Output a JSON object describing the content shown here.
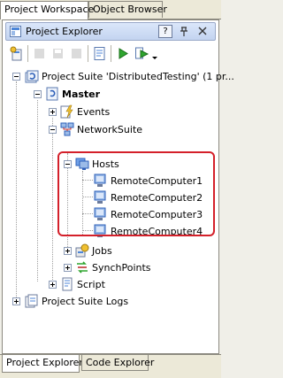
{
  "top_tabs": [
    {
      "label": "Project Workspace",
      "active": true
    },
    {
      "label": "Object Browser",
      "active": false
    }
  ],
  "explorer": {
    "title": "Project Explorer",
    "header_buttons": [
      "?",
      "pin",
      "x"
    ]
  },
  "toolbar": {
    "icons": [
      "add-item-icon",
      "edit-icon",
      "save-icon",
      "copy-icon",
      "properties-icon",
      "run-icon",
      "run-test-icon",
      "dropdown-icon"
    ]
  },
  "tree": {
    "suite": "Project Suite 'DistributedTesting' (1 pr...",
    "master": "Master",
    "events": "Events",
    "network_suite": "NetworkSuite",
    "hosts": "Hosts",
    "computers": [
      "RemoteComputer1",
      "RemoteComputer2",
      "RemoteComputer3",
      "RemoteComputer4"
    ],
    "jobs": "Jobs",
    "synch_points": "SynchPoints",
    "script": "Script",
    "suite_logs": "Project Suite Logs"
  },
  "bottom_tabs": [
    {
      "label": "Project Explorer",
      "active": true
    },
    {
      "label": "Code Explorer",
      "active": false
    }
  ],
  "colors": {
    "highlight": "#d4202a",
    "header_gradient_top": "#dbe7fa",
    "header_gradient_bottom": "#c3d4f0"
  }
}
